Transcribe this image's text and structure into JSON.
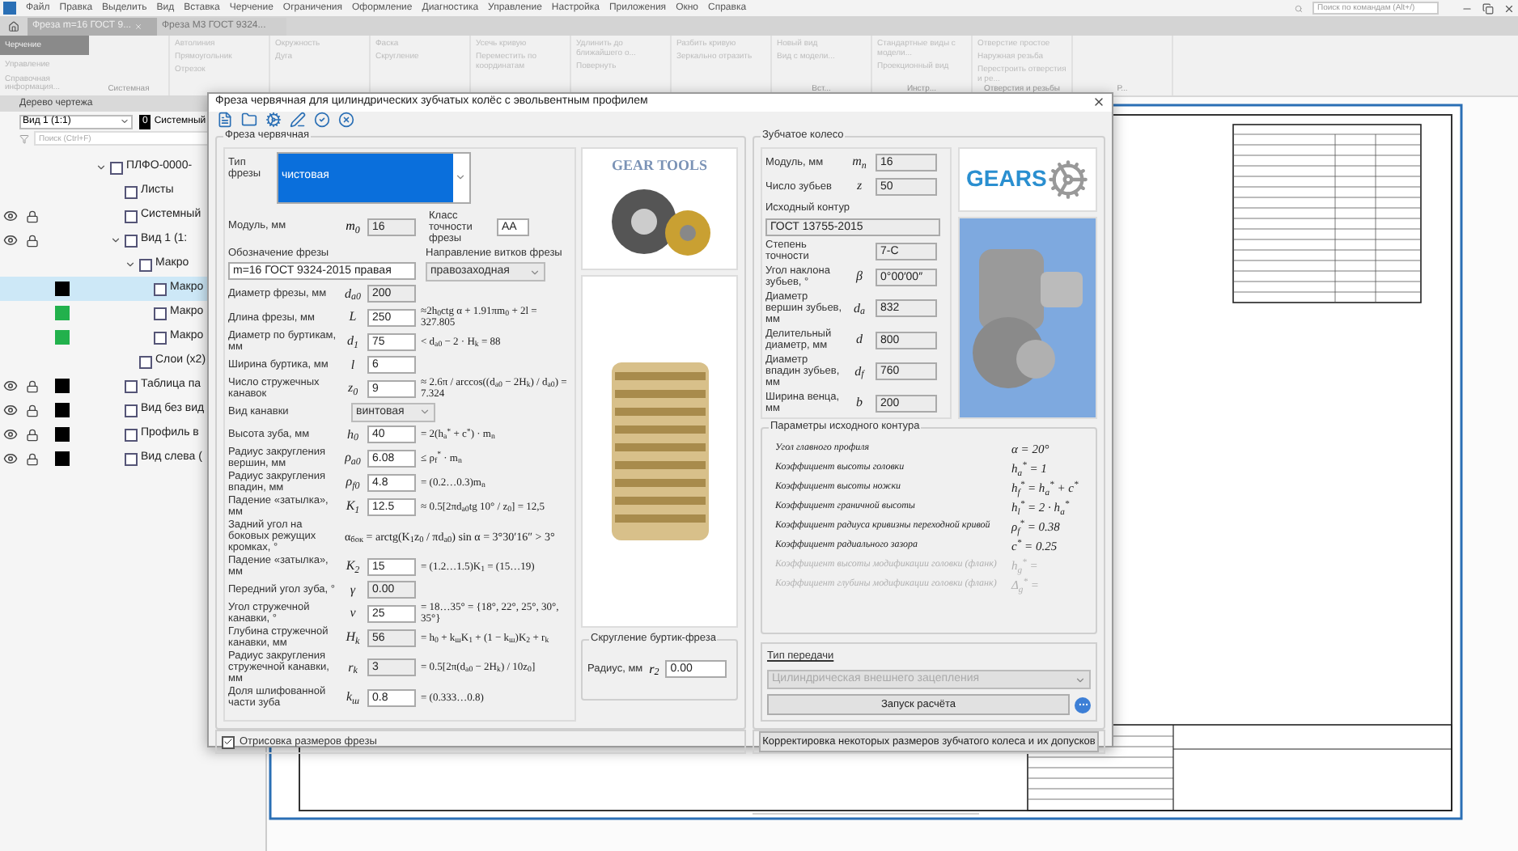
{
  "menu": [
    "Файл",
    "Правка",
    "Выделить",
    "Вид",
    "Вставка",
    "Черчение",
    "Ограничения",
    "Оформление",
    "Диагностика",
    "Управление",
    "Настройка",
    "Приложения",
    "Окно",
    "Справка"
  ],
  "tabs": [
    {
      "label": "Фреза m=16 ГОСТ 9...",
      "selected": true
    },
    {
      "label": "Фреза М3 ГОСТ 9324...",
      "selected": false
    }
  ],
  "command_search": {
    "placeholder": "Поиск по командам (Alt+/)"
  },
  "ribbon": {
    "modes": [
      {
        "label": "Черчение",
        "selected": true
      },
      {
        "label": "Управление",
        "selected": false
      },
      {
        "label": "Справочная информация...",
        "selected": false
      }
    ],
    "groups": [
      {
        "name": "Системная"
      },
      {
        "items": [
          "Автолиния",
          "Прямоугольник",
          "Отрезок"
        ]
      },
      {
        "items": [
          "Окружность",
          "Дуга"
        ]
      },
      {
        "items": [
          "Фаска",
          "Скругление"
        ]
      },
      {
        "items": [
          "Усечь кривую",
          "Переместить по координатам"
        ]
      },
      {
        "items": [
          "Удлинить до ближайшего о...",
          "Повернуть"
        ]
      },
      {
        "items": [
          "Разбить кривую",
          "Зеркально отразить"
        ]
      },
      {
        "name": "Вст...",
        "items": [
          "Новый вид",
          "Вид с модели..."
        ]
      },
      {
        "name": "Инстр...",
        "items": [
          "Стандартные виды с модели...",
          "Проекционный вид"
        ]
      },
      {
        "name": "Отверстия и резьбы",
        "items": [
          "Отверстие простое",
          "Наружная резьба",
          "Перестроить отверстия и ре..."
        ]
      },
      {
        "name": "Р..."
      }
    ]
  },
  "tree": {
    "title": "Дерево чертежа",
    "view_select": "Вид 1 (1:1)",
    "layer_badge": "0",
    "layer_select": "Системный",
    "search": {
      "placeholder": "Поиск (Ctrl+F)"
    },
    "items": [
      {
        "label": "ПЛФО-0000-",
        "selected": false,
        "visible": false,
        "children": [
          {
            "label": "Листы",
            "selected": false,
            "visible": false
          },
          {
            "label": "Системный",
            "selected": false,
            "visible": true
          },
          {
            "label": "Вид 1 (1:",
            "selected": false,
            "visible": true,
            "children": [
              {
                "label": "Макро",
                "selected": false,
                "visible": false,
                "children": [
                  {
                    "label": "Макро",
                    "selected": true,
                    "visible": false,
                    "color": "#000000"
                  },
                  {
                    "label": "Макро",
                    "selected": false,
                    "visible": false,
                    "color": "#22b14c"
                  },
                  {
                    "label": "Макро",
                    "selected": false,
                    "visible": false,
                    "color": "#22b14c"
                  }
                ]
              },
              {
                "label": "Слои (x2)",
                "selected": false,
                "visible": false
              }
            ]
          },
          {
            "label": "Таблица па",
            "selected": false,
            "visible": true,
            "color": "#000000"
          },
          {
            "label": "Вид без вид",
            "selected": false,
            "visible": true,
            "color": "#000000"
          },
          {
            "label": "Профиль в",
            "selected": false,
            "visible": true,
            "color": "#000000"
          },
          {
            "label": "Вид слева (",
            "selected": false,
            "visible": true,
            "color": "#000000"
          }
        ]
      }
    ]
  },
  "dialog": {
    "title": "Фреза червячная для цилиндрических зубчатых колёс с эвольвентным профилем",
    "hob": {
      "title": "Фреза червячная",
      "type": {
        "label": "Тип фрезы",
        "value": "чистовая"
      },
      "module": {
        "label": "Модуль, мм",
        "symbol": "m$_{0}$",
        "value": "16"
      },
      "accuracy": {
        "label": "Класс точности фрезы",
        "value": "AA"
      },
      "designation": {
        "label": "Обозначение фрезы",
        "value": "m=16 ГОСТ 9324-2015 правая"
      },
      "direction": {
        "label": "Направление витков фрезы",
        "value": "правозаходная"
      },
      "rows": [
        {
          "kind": "readonly",
          "label": "Диаметр фрезы, мм",
          "symbol": "d$_{a0}$",
          "value": "200"
        },
        {
          "kind": "input",
          "label": "Длина фрезы, мм",
          "symbol": "L",
          "value": "250",
          "formula": "≈2h$_{0}$ctg α + 1.91πm$_{0}$ + 2l = 327.805"
        },
        {
          "kind": "input",
          "label": "Диаметр по буртикам, мм",
          "symbol": "d$_{1}$",
          "value": "75",
          "formula": "< d$_{a0}$ − 2 · H$_{k}$ = 88"
        },
        {
          "kind": "input",
          "label": "Ширина буртика, мм",
          "symbol": "l",
          "value": "6"
        },
        {
          "kind": "input",
          "label": "Число стружечных канавок",
          "symbol": "z$_{0}$",
          "value": "9",
          "formula": "≈ 2.6π / arccos((d$_{a0}$ − 2H$_{k}$) / d$_{a0}$) = 7.324"
        },
        {
          "kind": "select",
          "label": "Вид канавки",
          "value": "винтовая"
        },
        {
          "kind": "input",
          "label": "Высота зуба, мм",
          "symbol": "h$_{0}$",
          "value": "40",
          "formula": "= 2(h$_{a}$$^{*}$ + c$^{*}$) · m$_{n}$"
        },
        {
          "kind": "input",
          "label": "Радиус закругления вершин, мм",
          "symbol": "ρ$_{a0}$",
          "value": "6.08",
          "formula": "≤ ρ$_{f}$$^{*}$ · m$_{n}$"
        },
        {
          "kind": "input",
          "label": "Радиус закругления впадин, мм",
          "symbol": "ρ$_{f0}$",
          "value": "4.8",
          "formula": "= (0.2…0.3)m$_{n}$"
        },
        {
          "kind": "input",
          "label": "Падение «затылка», мм",
          "symbol": "K$_{1}$",
          "value": "12.5",
          "formula": "≈ 0.5[2πd$_{a0}$tg 10° / z$_{0}$] = 12,5"
        },
        {
          "kind": "formula",
          "label": "Задний угол на боковых режущих кромках, °",
          "formula": "α$_{бок}$ = arctg(K$_{1}$z$_{0}$ / πd$_{a0}$) sin α = 3°30′16″ > 3°"
        },
        {
          "kind": "input",
          "label": "Падение «затылка», мм",
          "symbol": "K$_{2}$",
          "value": "15",
          "formula": "= (1.2…1.5)K$_{1}$ = (15…19)"
        },
        {
          "kind": "readonly",
          "label": "Передний угол зуба, °",
          "symbol": "γ",
          "value": "0.00"
        },
        {
          "kind": "input",
          "label": "Угол стружечной канавки, °",
          "symbol": "ν",
          "value": "25",
          "formula": "= 18…35° = {18°, 22°, 25°, 30°, 35°}"
        },
        {
          "kind": "readonly",
          "label": "Глубина стружечной канавки, мм",
          "symbol": "H$_{k}$",
          "value": "56",
          "formula": "= h$_{0}$ + k$_{ш}$K$_{1}$ + (1 − k$_{ш}$)K$_{2}$ + r$_{k}$"
        },
        {
          "kind": "readonly",
          "label": "Радиус закругления стружечной канавки, мм",
          "symbol": "r$_{k}$",
          "value": "3",
          "formula": "= 0.5[2π(d$_{a0}$ − 2H$_{k}$) / 10z$_{0}$]"
        },
        {
          "kind": "input",
          "label": "Доля шлифованной части зуба",
          "symbol": "k$_{ш}$",
          "value": "0.8",
          "formula": "= (0.333…0.8)"
        }
      ],
      "logo": "GEAR TOOLS",
      "fillet": {
        "title": "Скругление буртик-фреза",
        "label": "Радиус, мм",
        "symbol": "r$_{2}$",
        "value": "0.00"
      }
    },
    "gear": {
      "title": "Зубчатое колесо",
      "rows": [
        {
          "kind": "readonly",
          "label": "Модуль, мм",
          "symbol": "m$_{n}$",
          "value": "16"
        },
        {
          "kind": "readonly",
          "label": "Число зубьев",
          "symbol": "z",
          "value": "50"
        },
        {
          "kind": "wide",
          "label": "Исходный контур",
          "value": "ГОСТ 13755-2015"
        },
        {
          "kind": "readonly",
          "label": "Степень точности",
          "value": "7-C"
        },
        {
          "kind": "readonly",
          "label": "Угол наклона зубьев, °",
          "symbol": "β",
          "value": "0°00′00″"
        },
        {
          "kind": "readonly",
          "label": "Диаметр вершин зубьев, мм",
          "symbol": "d$_{a}$",
          "value": "832"
        },
        {
          "kind": "readonly",
          "label": "Делительный диаметр, мм",
          "symbol": "d",
          "value": "800"
        },
        {
          "kind": "readonly",
          "label": "Диаметр впадин зубьев, мм",
          "symbol": "d$_{f}$",
          "value": "760"
        },
        {
          "kind": "readonly",
          "label": "Ширина венца, мм",
          "symbol": "b",
          "value": "200"
        }
      ],
      "logo": "GEARS",
      "profile": {
        "title": "Параметры исходного контура",
        "rows": [
          {
            "label": "Угол главного профиля",
            "formula": "α = 20°",
            "disabled": false
          },
          {
            "label": "Коэффициент высоты головки",
            "formula": "h$_{a}$$^{*}$ = 1",
            "disabled": false
          },
          {
            "label": "Коэффициент высоты ножки",
            "formula": "h$_{f}$$^{*}$ = h$_{a}$$^{*}$ + c$^{*}$",
            "disabled": false
          },
          {
            "label": "Коэффициент граничной высоты",
            "formula": "h$_{l}$$^{*}$ = 2 · h$_{a}$$^{*}$",
            "disabled": false
          },
          {
            "label": "Коэффициент радиуса кривизны переходной кривой",
            "formula": "ρ$_{f}$$^{*}$ = 0.38",
            "disabled": false
          },
          {
            "label": "Коэффициент радиального зазора",
            "formula": "c$^{*}$ = 0.25",
            "disabled": false
          },
          {
            "label": "Коэффициент высоты модификации головки (фланк)",
            "formula": "h$_{g}$$^{*}$ =",
            "disabled": true
          },
          {
            "label": "Коэффициент глубины модификации головки (фланк)",
            "formula": "Δ$_{g}$$^{*}$ =",
            "disabled": true
          }
        ]
      },
      "transmission": {
        "label": "Тип передачи",
        "value": "Цилиндрическая внешнего зацепления",
        "disabled": true
      },
      "run_button": "Запуск расчёта"
    },
    "draw_dimensions": {
      "label": "Отрисовка размеров фрезы",
      "checked": true
    },
    "correct_button": "Корректировка некоторых размеров зубчатого колеса и их допусков"
  }
}
